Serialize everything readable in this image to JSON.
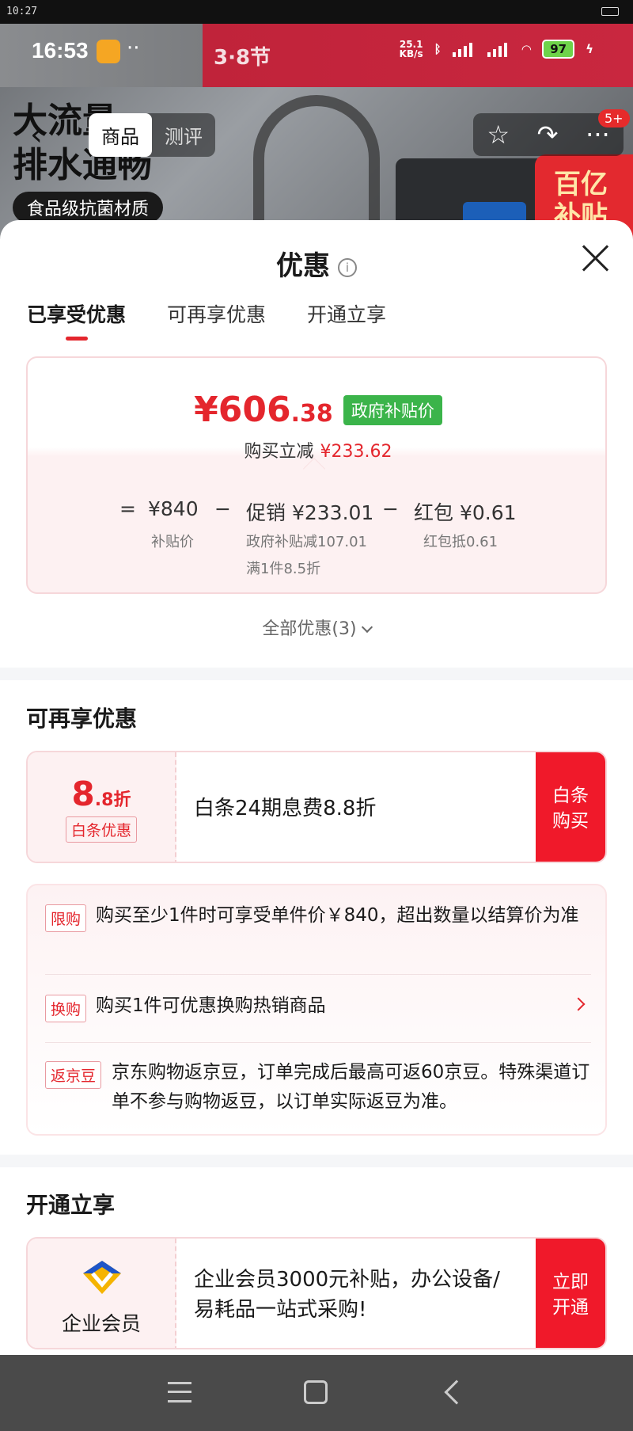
{
  "host_status": {
    "time": "10:27"
  },
  "hero": {
    "status_time": "16:53",
    "net_speed_value": "25.1",
    "net_speed_unit": "KB/s",
    "battery": "97",
    "promo_text": "3·8节",
    "headline_line1": "大流量",
    "headline_line2": "排水通畅",
    "sub_pill": "食品级抗菌材质",
    "subsidy_line1": "百亿",
    "subsidy_line2": "补贴",
    "tabs": [
      "商品",
      "测评"
    ],
    "cart_badge": "5+"
  },
  "sheet": {
    "title": "优惠",
    "tabs": [
      "已享受优惠",
      "可再享优惠",
      "开通立享"
    ],
    "enjoyed": {
      "price_symbol": "¥",
      "price_int": "606",
      "price_dec": ".38",
      "price_tag": "政府补贴价",
      "instant_label": "购买立减",
      "instant_value": "¥233.62",
      "eq": "=",
      "base_price": "¥840",
      "base_label": "补贴价",
      "minus1": "−",
      "promo_value": "促销 ¥233.01",
      "promo_sub1": "政府补贴减107.01",
      "promo_sub2": "满1件8.5折",
      "minus2": "−",
      "hongbao_value": "红包 ¥0.61",
      "hongbao_sub": "红包抵0.61"
    },
    "all_offers": "全部优惠(3)",
    "more_section_title": "可再享优惠",
    "baitiao": {
      "discount_big": "8",
      "discount_small": ".8折",
      "tag": "白条优惠",
      "desc": "白条24期息费8.8折",
      "cta_line1": "白条",
      "cta_line2": "购买"
    },
    "info_items": [
      {
        "tag": "限购",
        "text": "购买至少1件时可享受单件价￥840，超出数量以结算价为准"
      },
      {
        "tag": "换购",
        "text": "购买1件可优惠换购热销商品"
      },
      {
        "tag": "返京豆",
        "text": "京东购物返京豆，订单完成后最高可返60京豆。特殊渠道订单不参与购物返豆，以订单实际返豆为准。"
      }
    ],
    "open_section_title": "开通立享",
    "member": {
      "label": "企业会员",
      "desc": "企业会员3000元补贴，办公设备/易耗品一站式采购!",
      "cta_line1": "立即",
      "cta_line2": "开通"
    }
  },
  "colors": {
    "accent": "#e4262d",
    "gov_green": "#3bb44a",
    "cta_red": "#f0192a"
  }
}
